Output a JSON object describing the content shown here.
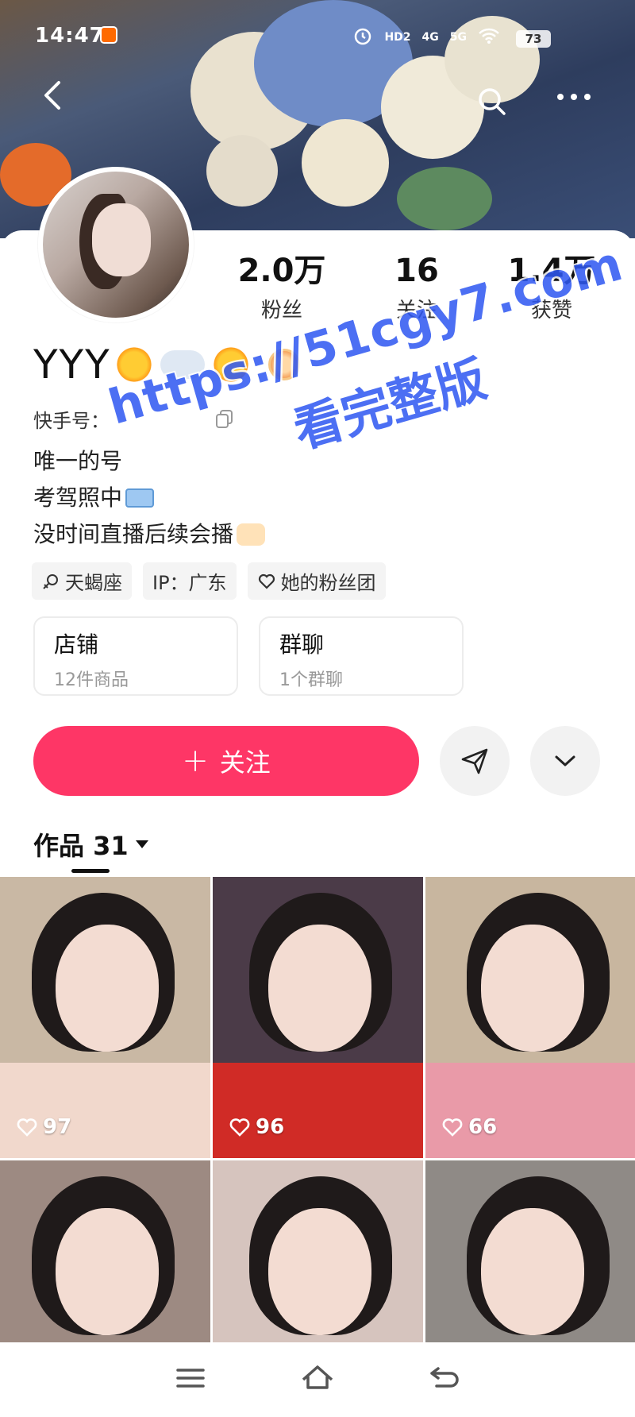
{
  "status_bar": {
    "time": "14:47",
    "indicators": [
      "HD2",
      "4G",
      "5G"
    ],
    "battery": "73"
  },
  "profile": {
    "username": "YYY",
    "stats": [
      {
        "value": "2.0万",
        "label": "粉丝"
      },
      {
        "value": "16",
        "label": "关注"
      },
      {
        "value": "1.4万",
        "label": "获赞"
      }
    ],
    "id_label": "快手号：",
    "bio": [
      "唯一的号",
      "考驾照中",
      "没时间直播后续会播"
    ],
    "tags": [
      {
        "icon": "female-icon",
        "label": "天蝎座"
      },
      {
        "icon": null,
        "label": "IP：广东"
      },
      {
        "icon": "heart-outline-icon",
        "label": "她的粉丝团"
      }
    ],
    "entries": [
      {
        "title": "店铺",
        "subtitle": "12件商品"
      },
      {
        "title": "群聊",
        "subtitle": "1个群聊"
      }
    ]
  },
  "actions": {
    "follow_plus": "+",
    "follow_label": "关注"
  },
  "works": {
    "tab_label": "作品 31",
    "items": [
      {
        "likes": "97",
        "bg": "#c9b8a4",
        "cloth": "#f1d8cc"
      },
      {
        "likes": "96",
        "bg": "#4b3b48",
        "cloth": "#d02b26"
      },
      {
        "likes": "66",
        "bg": "#c8b69f",
        "cloth": "#e99aa8"
      },
      {
        "likes": "",
        "bg": "#9d8a82",
        "cloth": "#ead8d3"
      },
      {
        "likes": "",
        "bg": "#d6c4be",
        "cloth": "#f4e4de"
      },
      {
        "likes": "",
        "bg": "#8f8a86",
        "cloth": "#d8d4d2"
      }
    ]
  },
  "watermark": {
    "url": "https://51cgy7.com",
    "text": "看完整版"
  },
  "colors": {
    "accent": "#fe3666",
    "watermark": "#2f58f2"
  }
}
